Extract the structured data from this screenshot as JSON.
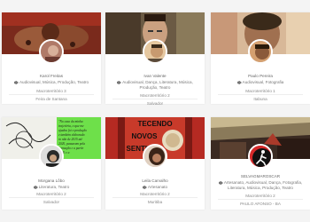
{
  "cards": [
    {
      "name": "Karol Freitas",
      "tags": "Audiovisual, Música, Produção, Teatro",
      "lines": [
        "Macroterritório 3",
        "Feira de Santana"
      ]
    },
    {
      "name": "Ivan Valente",
      "tags": "Audiovisual, Dança, Literatura, Música, Produção, Teatro",
      "lines": [
        "Macroterritório 2",
        "Salvador"
      ]
    },
    {
      "name": "Paulo Pereira",
      "tags": "Audiovisual, Fotografia",
      "lines": [
        "Macroterritório 1",
        "Itabuna"
      ]
    },
    {
      "name": "Morgana Lôbo",
      "tags": "Literatura, Teatro",
      "lines": [
        "Macroterritório 2",
        "Salvador"
      ]
    },
    {
      "name": "Leila Carvalho",
      "tags": "Artesanato",
      "lines": [
        "Macroterritório 2",
        "Muritiba"
      ]
    },
    {
      "name": "SELVAGMAROSCAR",
      "tags": "Artesanato, Audiovisual, Dança, Fotografia, Literatura, Música, Produção, Teatro",
      "lines": [
        "Macroterritório 2",
        "PAULO AFONSO - BA"
      ]
    }
  ],
  "banner_text": {
    "card5_sign": [
      "TECENDO",
      "NOVOS",
      "SENTIDOS"
    ],
    "card4_note": [
      "\"No caso da minha",
      "trajetória, o que me",
      "ajudou foi o produção",
      "e também elaborado",
      "ro não de 2015 até",
      "2020, passaram pela",
      "formação e a partir",
      "2020 e a"
    ]
  },
  "colors": {
    "page_bg": "#f4f4f4",
    "card_bg": "#ffffff",
    "text": "#666666",
    "tag_icon": "#777777"
  }
}
